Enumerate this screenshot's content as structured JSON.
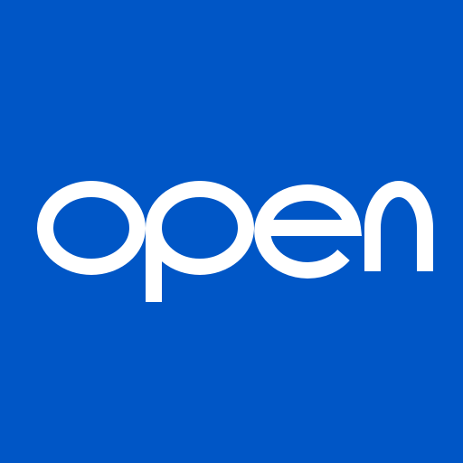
{
  "brand": {
    "wordmark": "open",
    "background_color": "#0056c6",
    "text_color": "#ffffff"
  }
}
